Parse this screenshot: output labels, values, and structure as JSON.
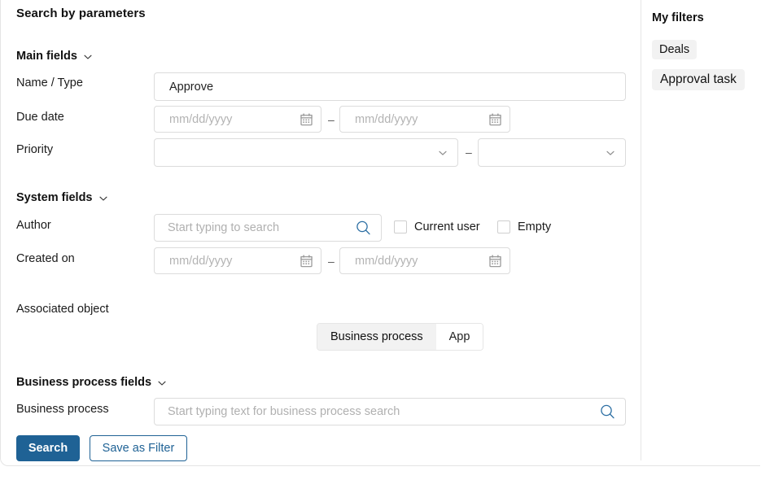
{
  "page": {
    "title": "Search by parameters"
  },
  "sections": {
    "main_fields": {
      "label": "Main fields",
      "chevron_icon": "chevron-down-icon"
    },
    "system_fields": {
      "label": "System fields",
      "chevron_icon": "chevron-down-icon"
    },
    "business_process_fields": {
      "label": "Business process fields",
      "chevron_icon": "chevron-down-icon"
    }
  },
  "fields": {
    "name_type": {
      "label": "Name / Type",
      "value": "Approve",
      "placeholder": ""
    },
    "due_date": {
      "label": "Due date",
      "from_placeholder": "mm/dd/yyyy",
      "to_placeholder": "mm/dd/yyyy",
      "separator": "–",
      "calendar_icon": "calendar-icon"
    },
    "priority": {
      "label": "Priority",
      "from_value": "",
      "to_value": "",
      "separator": "–",
      "chevron_icon": "chevron-down-icon"
    },
    "author": {
      "label": "Author",
      "placeholder": "Start typing to search",
      "search_icon": "search-icon",
      "checkbox_current_user": "Current user",
      "checkbox_empty": "Empty",
      "current_user_checked": false,
      "empty_checked": false
    },
    "created_on": {
      "label": "Created on",
      "from_placeholder": "mm/dd/yyyy",
      "to_placeholder": "mm/dd/yyyy",
      "separator": "–",
      "calendar_icon": "calendar-icon"
    },
    "associated_object": {
      "label": "Associated object",
      "options": [
        "Business process",
        "App"
      ],
      "selected": "Business process"
    },
    "business_process": {
      "label": "Business process",
      "placeholder": "Start typing text for business process search",
      "search_icon": "search-icon"
    }
  },
  "actions": {
    "search_label": "Search",
    "save_as_filter_label": "Save as Filter"
  },
  "sidebar": {
    "title": "My filters",
    "filters": [
      {
        "label": "Deals"
      },
      {
        "label": "Approval task"
      }
    ]
  },
  "colors": {
    "primary": "#1f6295",
    "segment_active_bg": "#f2f2f2",
    "chip_bg": "#f2f2f2",
    "border": "#dcdcdc",
    "placeholder": "#b3b3b3"
  }
}
